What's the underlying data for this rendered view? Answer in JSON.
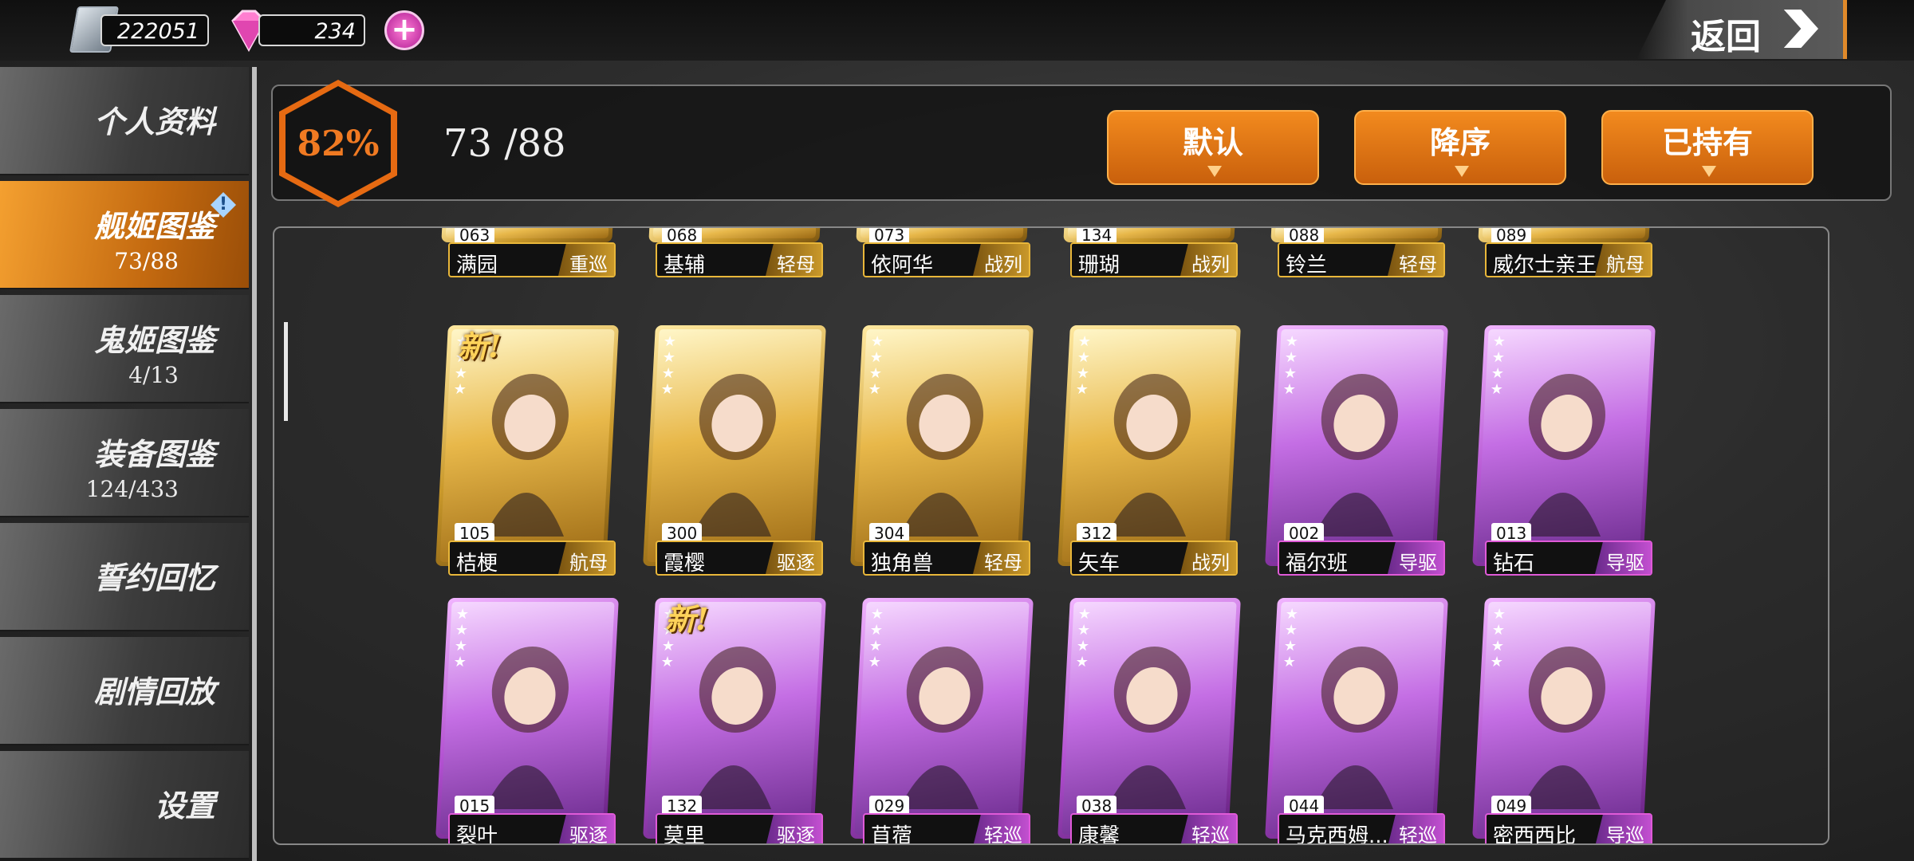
{
  "topbar": {
    "fuel": "222051",
    "gems": "234",
    "back_label": "返回"
  },
  "sidebar": {
    "items": [
      {
        "label": "个人资料",
        "count": ""
      },
      {
        "label": "舰姬图鉴",
        "count": "73/88",
        "active": true
      },
      {
        "label": "鬼姬图鉴",
        "count": "4/13"
      },
      {
        "label": "装备图鉴",
        "count": "124/433"
      },
      {
        "label": "誓约回忆",
        "count": ""
      },
      {
        "label": "剧情回放",
        "count": ""
      },
      {
        "label": "设置",
        "count": ""
      }
    ]
  },
  "header": {
    "percent": "82%",
    "collected": "73 /88",
    "sort": [
      "默认",
      "降序",
      "已持有"
    ]
  },
  "cards": {
    "row0": [
      {
        "id": "063",
        "name": "满园",
        "type": "重巡",
        "rarity": "gold"
      },
      {
        "id": "068",
        "name": "基辅",
        "type": "轻母",
        "rarity": "gold"
      },
      {
        "id": "073",
        "name": "依阿华",
        "type": "战列",
        "rarity": "gold"
      },
      {
        "id": "134",
        "name": "珊瑚",
        "type": "战列",
        "rarity": "gold"
      },
      {
        "id": "088",
        "name": "铃兰",
        "type": "轻母",
        "rarity": "gold"
      },
      {
        "id": "089",
        "name": "威尔士亲王",
        "type": "航母",
        "rarity": "gold"
      }
    ],
    "row1": [
      {
        "id": "105",
        "name": "桔梗",
        "type": "航母",
        "rarity": "gold",
        "is_new": true
      },
      {
        "id": "300",
        "name": "霞樱",
        "type": "驱逐",
        "rarity": "gold"
      },
      {
        "id": "304",
        "name": "独角兽",
        "type": "轻母",
        "rarity": "gold"
      },
      {
        "id": "312",
        "name": "矢车",
        "type": "战列",
        "rarity": "gold"
      },
      {
        "id": "002",
        "name": "福尔班",
        "type": "导驱",
        "rarity": "purple"
      },
      {
        "id": "013",
        "name": "钻石",
        "type": "导驱",
        "rarity": "purple"
      }
    ],
    "row2": [
      {
        "id": "015",
        "name": "裂叶",
        "type": "驱逐",
        "rarity": "purple"
      },
      {
        "id": "132",
        "name": "莫里",
        "type": "驱逐",
        "rarity": "purple",
        "is_new": true
      },
      {
        "id": "029",
        "name": "苜蓿",
        "type": "轻巡",
        "rarity": "purple"
      },
      {
        "id": "038",
        "name": "康馨",
        "type": "轻巡",
        "rarity": "purple"
      },
      {
        "id": "044",
        "name": "马克西姆...",
        "type": "轻巡",
        "rarity": "purple"
      },
      {
        "id": "049",
        "name": "密西西比",
        "type": "导巡",
        "rarity": "purple"
      }
    ],
    "new_label": "新!",
    "stars": "★\n★\n★\n★"
  },
  "colors": {
    "accent": "#e66a12",
    "gold": "#e9b73a",
    "purple": "#e05ad8"
  },
  "icons": [
    "fuel-icon",
    "gem-icon",
    "plus-icon",
    "chevron-right-icon",
    "alert-icon",
    "star-icon"
  ]
}
